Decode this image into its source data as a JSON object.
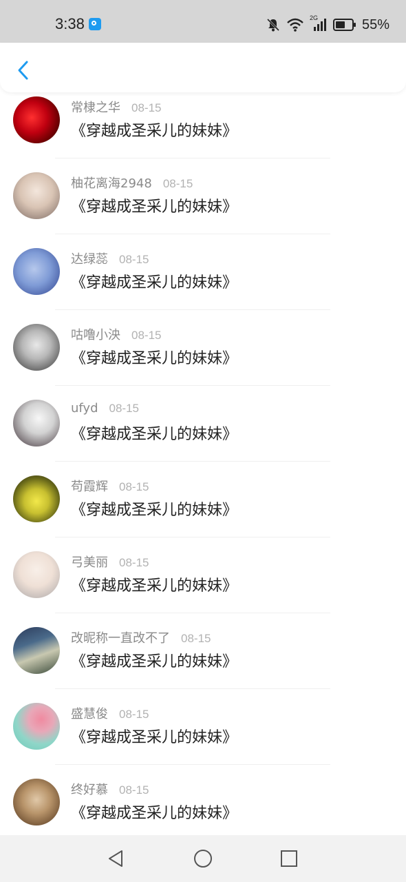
{
  "status_bar": {
    "time": "3:38",
    "battery": "55%",
    "network": "2G",
    "icons": [
      "app-notification-icon",
      "mute-bell-icon",
      "wifi-icon",
      "signal-icon",
      "battery-icon"
    ]
  },
  "header": {
    "back_icon": "chevron-left-icon"
  },
  "colors": {
    "accent": "#1e9bf0",
    "username": "#8a8a8a",
    "date": "#b2b2b2",
    "title": "#222222"
  },
  "items": [
    {
      "username": "常棣之华",
      "date": "08-15",
      "title": "《穿越成圣采儿的妹妹》"
    },
    {
      "username": "柚花离海2948",
      "date": "08-15",
      "title": "《穿越成圣采儿的妹妹》"
    },
    {
      "username": "达绿蕊",
      "date": "08-15",
      "title": "《穿越成圣采儿的妹妹》"
    },
    {
      "username": "咕噜小泱",
      "date": "08-15",
      "title": "《穿越成圣采儿的妹妹》"
    },
    {
      "username": "ufyd",
      "date": "08-15",
      "title": "《穿越成圣采儿的妹妹》"
    },
    {
      "username": "苟霞辉",
      "date": "08-15",
      "title": "《穿越成圣采儿的妹妹》"
    },
    {
      "username": "弓美丽",
      "date": "08-15",
      "title": "《穿越成圣采儿的妹妹》"
    },
    {
      "username": "改昵称一直改不了",
      "date": "08-15",
      "title": "《穿越成圣采儿的妹妹》"
    },
    {
      "username": "盛慧俊",
      "date": "08-15",
      "title": "《穿越成圣采儿的妹妹》"
    },
    {
      "username": "终好慕",
      "date": "08-15",
      "title": "《穿越成圣采儿的妹妹》"
    }
  ],
  "nav_bar": {
    "icons": [
      "back-triangle-icon",
      "home-circle-icon",
      "recents-square-icon"
    ]
  }
}
